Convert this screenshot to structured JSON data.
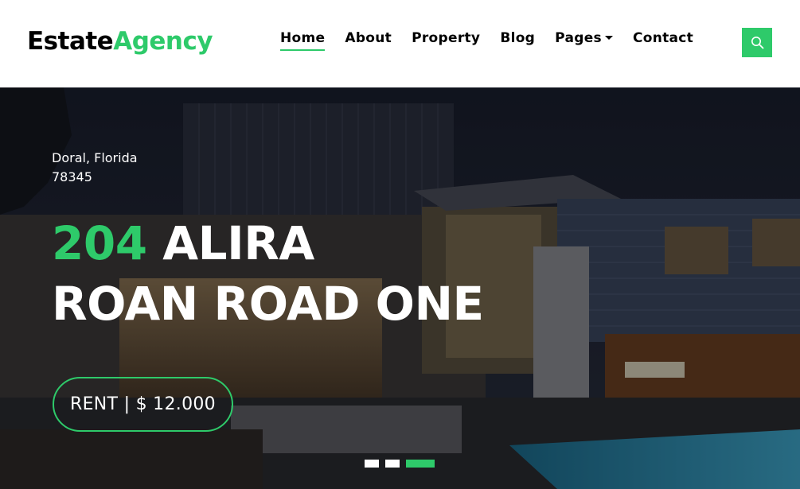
{
  "brand": {
    "part1": "Estate",
    "part2": "Agency"
  },
  "nav": {
    "items": [
      {
        "label": "Home",
        "active": true
      },
      {
        "label": "About"
      },
      {
        "label": "Property"
      },
      {
        "label": "Blog"
      },
      {
        "label": "Pages",
        "dropdown": true
      },
      {
        "label": "Contact"
      }
    ],
    "search_icon": "search-icon"
  },
  "hero": {
    "location_line1": "Doral, Florida",
    "location_line2": "78345",
    "title_number": "204",
    "title_line1_rest": " ALIRA",
    "title_line2": "ROAN ROAD ONE",
    "rent_label": "RENT | $ 12.000",
    "slides": 3,
    "active_slide": 3
  },
  "colors": {
    "accent": "#2eca6a",
    "text": "#000000",
    "white": "#ffffff"
  }
}
